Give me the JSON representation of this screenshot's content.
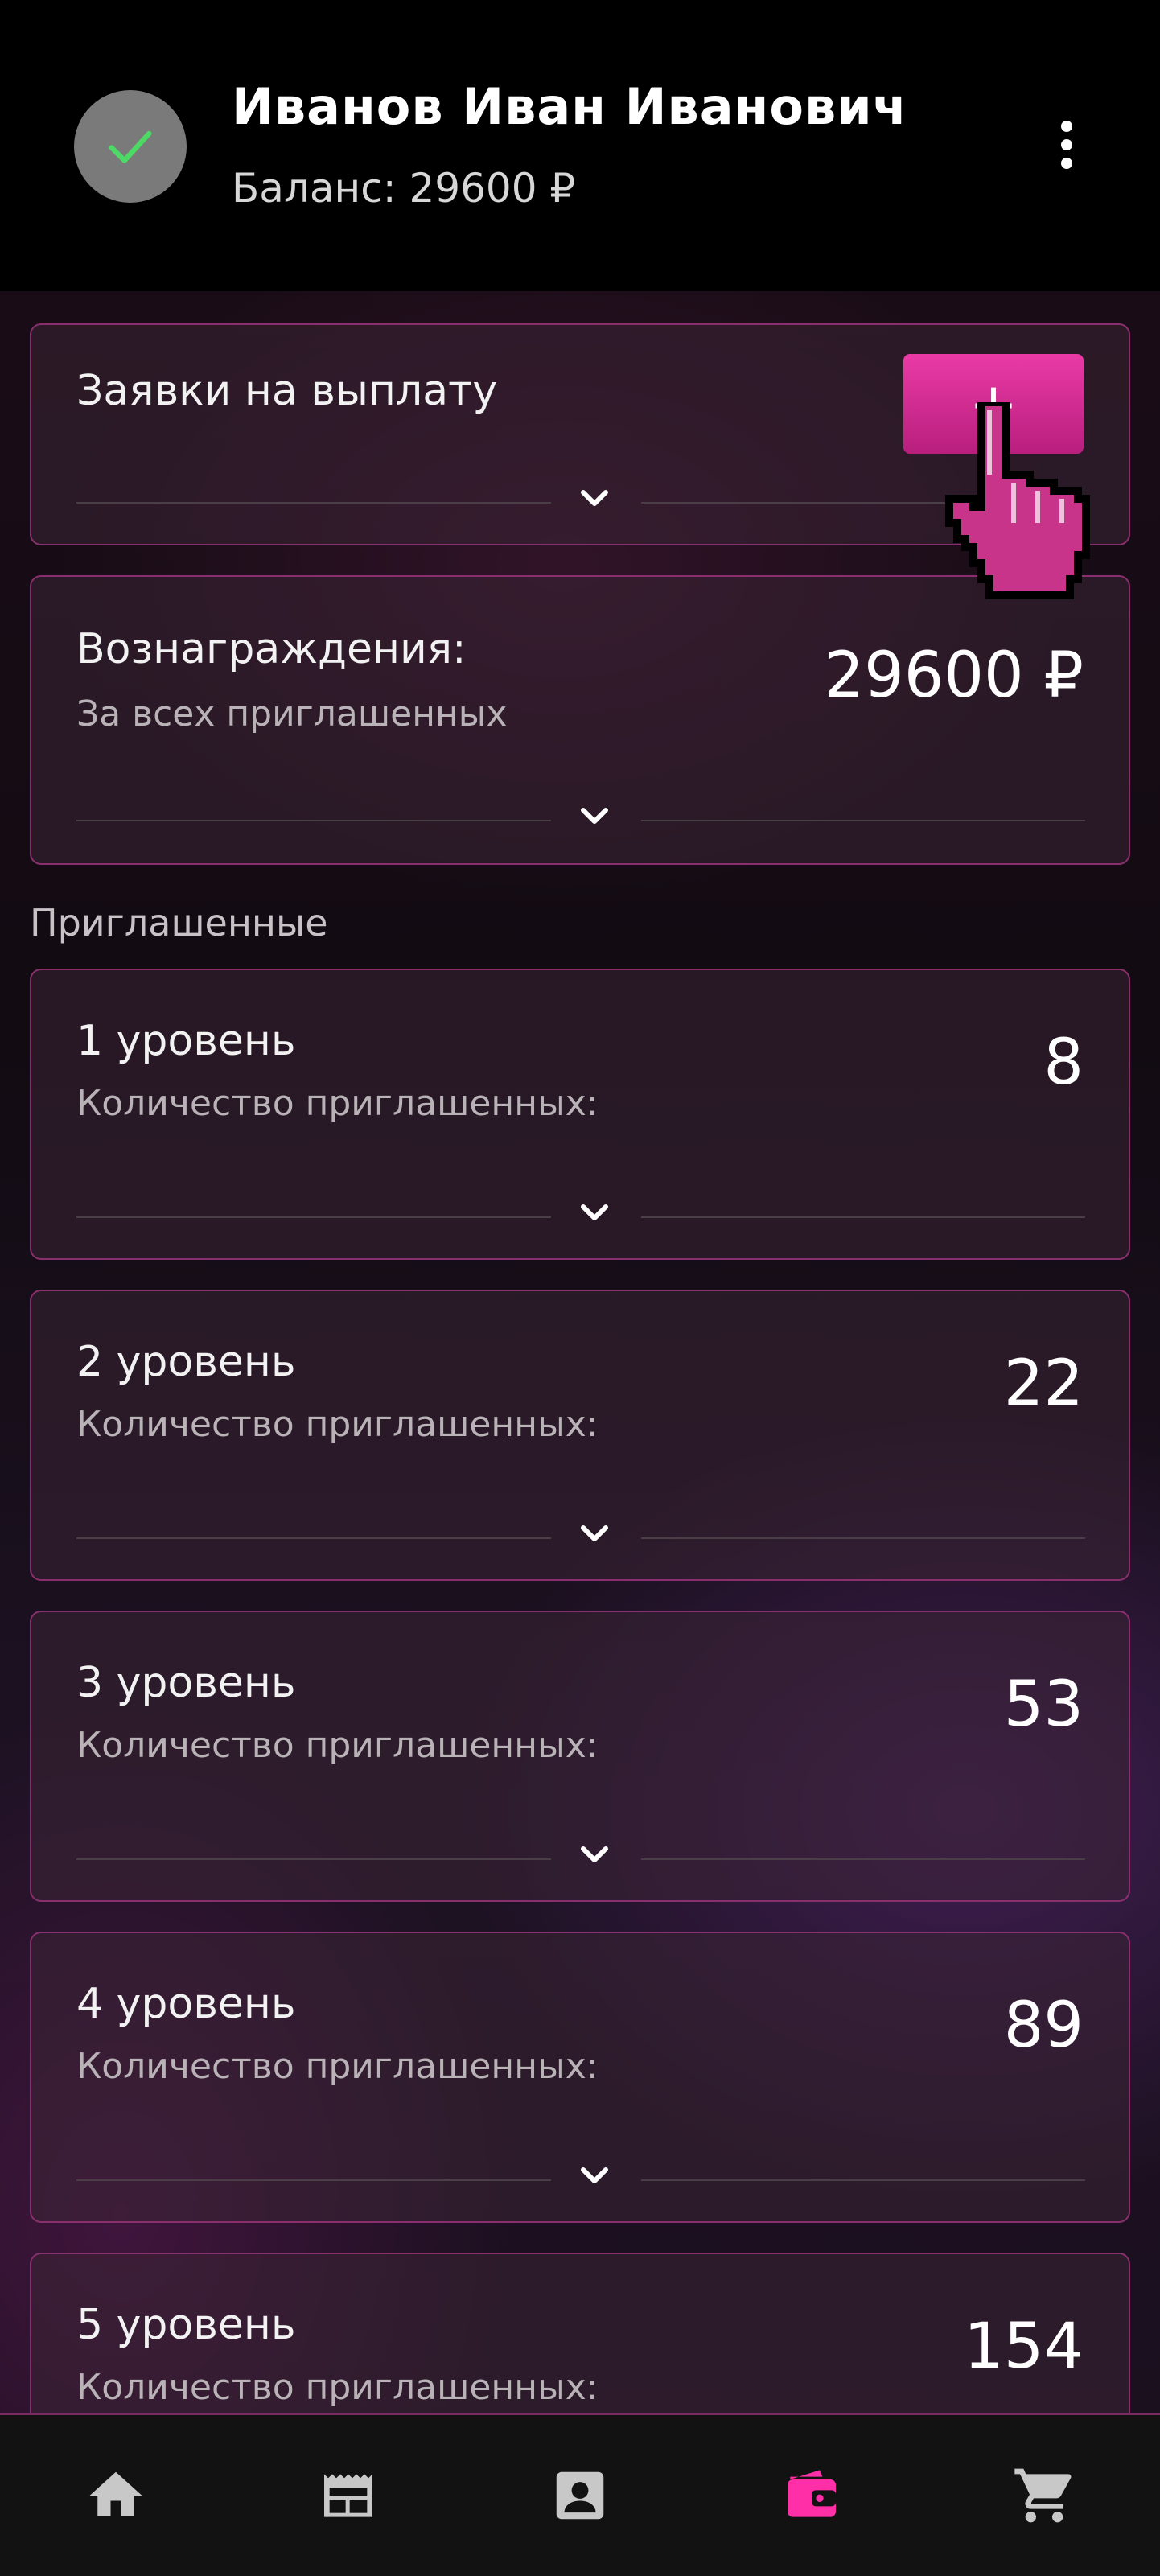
{
  "header": {
    "user_name": "Иванов Иван Иванович",
    "balance": "Баланс: 29600 ₽",
    "avatar_icon": "check-icon",
    "menu_icon": "more-vertical-icon"
  },
  "payout_card": {
    "title": "Заявки на выплату",
    "add_button_label": "+",
    "expand_icon": "chevron-down-icon"
  },
  "rewards_card": {
    "title": "Вознаграждения:",
    "subtitle": "За всех приглашенных",
    "value": "29600 ₽"
  },
  "invited": {
    "section_label": "Приглашенные",
    "levels": [
      {
        "title": "1 уровень",
        "subtitle": "Количество приглашенных:",
        "value": "8"
      },
      {
        "title": "2 уровень",
        "subtitle": "Количество приглашенных:",
        "value": "22"
      },
      {
        "title": "3 уровень",
        "subtitle": "Количество приглашенных:",
        "value": "53"
      },
      {
        "title": "4 уровень",
        "subtitle": "Количество приглашенных:",
        "value": "89"
      },
      {
        "title": "5 уровень",
        "subtitle": "Количество приглашенных:",
        "value": "154"
      }
    ]
  },
  "bottom_nav": {
    "items": [
      {
        "icon": "home-icon",
        "active": false
      },
      {
        "icon": "newspaper-icon",
        "active": false
      },
      {
        "icon": "contact-card-icon",
        "active": false
      },
      {
        "icon": "wallet-icon",
        "active": true
      },
      {
        "icon": "cart-icon",
        "active": false
      }
    ]
  },
  "colors": {
    "accent": "#ea3aa6",
    "card_border": "#8a2f6e",
    "avatar_bg": "#7a7a7a",
    "check_green": "#4cd964",
    "nav_icon": "#c8c8c8"
  }
}
